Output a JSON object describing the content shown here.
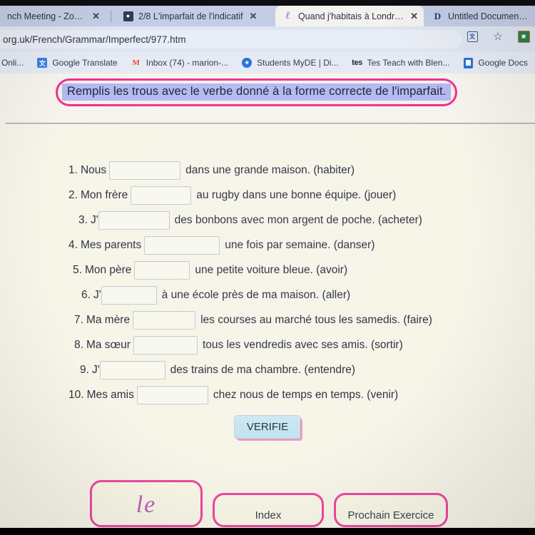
{
  "browser": {
    "tabs": [
      {
        "title": "nch Meeting - Zoom",
        "icon": "zoom-icon",
        "active": false,
        "has_close": true
      },
      {
        "title": "2/8  L'imparfait de l'indicatif",
        "icon": "contact-card-icon",
        "active": false,
        "has_close": true
      },
      {
        "title": "Quand j'habitais à Londres...",
        "icon": "pen-icon",
        "active": true,
        "has_close": true
      },
      {
        "title": "Untitled Document | Doc",
        "icon": "google-docs-icon",
        "active": false,
        "has_close": false
      }
    ],
    "close_glyph": "✕",
    "url": "org.uk/French/Grammar/Imperfect/977.htm",
    "omnibox_icons": [
      {
        "name": "translate-icon",
        "glyph": "文"
      },
      {
        "name": "bookmark-star-icon",
        "glyph": "☆"
      },
      {
        "name": "profile-icon",
        "glyph": "◧"
      }
    ],
    "bookmarks": [
      {
        "label": "Onli...",
        "icon": "generic-bookmark-icon"
      },
      {
        "label": "Google Translate",
        "icon": "google-translate-icon",
        "glyph": "文"
      },
      {
        "label": "Inbox (74) - marion-...",
        "icon": "gmail-icon",
        "glyph": "M"
      },
      {
        "label": "Students MyDE | Di...",
        "icon": "students-myde-icon",
        "glyph": "✹"
      },
      {
        "label": "Tes Teach with Blen...",
        "icon": "tes-icon",
        "glyph": "tes"
      },
      {
        "label": "Google Docs",
        "icon": "google-docs-icon"
      },
      {
        "label": "",
        "icon": "apps-grid-icon"
      }
    ]
  },
  "exercise": {
    "instruction": "Remplis les trous avec le verbe donné à la forme correcte de l'imparfait.",
    "questions": [
      {
        "num": "1.",
        "lead": "Nous",
        "input_width": 100,
        "tail": "dans une grande maison. (habiter)"
      },
      {
        "num": "2.",
        "lead": "Mon frère",
        "input_width": 85,
        "tail": "au rugby dans une bonne équipe. (jouer)"
      },
      {
        "num": "3.",
        "lead": "J'",
        "input_width": 100,
        "tail": "des bonbons avec mon argent de poche. (acheter)"
      },
      {
        "num": "4.",
        "lead": "Mes parents",
        "input_width": 106,
        "tail": "une fois par semaine. (danser)"
      },
      {
        "num": "5.",
        "lead": "Mon père",
        "input_width": 78,
        "tail": "une petite voiture bleue. (avoir)"
      },
      {
        "num": "6.",
        "lead": "J'",
        "input_width": 78,
        "tail": "à une école près de ma maison. (aller)"
      },
      {
        "num": "7.",
        "lead": "Ma mère",
        "input_width": 88,
        "tail": "les courses au marché tous les samedis. (faire)"
      },
      {
        "num": "8.",
        "lead": "Ma sœur",
        "input_width": 90,
        "tail": "tous les vendredis avec ses amis. (sortir)"
      },
      {
        "num": "9.",
        "lead": "J'",
        "input_width": 92,
        "tail": "des trains de ma chambre. (entendre)"
      },
      {
        "num": "10.",
        "lead": "Mes amis",
        "input_width": 100,
        "tail": "chez nous de temps en temps. (venir)"
      }
    ],
    "verify_button": "VERIFIE",
    "logo_mark": "le",
    "index_button": "Index",
    "next_button": "Prochain Exercice"
  },
  "colors": {
    "instruction_border": "#e8338c",
    "instruction_highlight": "#b4b8ee",
    "footer_border": "#e8489d",
    "verify_bg": "#bfe2ee",
    "page_bg": "#f7f5e9",
    "tabstrip_bg": "#c3cde4",
    "active_tab_bg": "#f4f2ee"
  }
}
